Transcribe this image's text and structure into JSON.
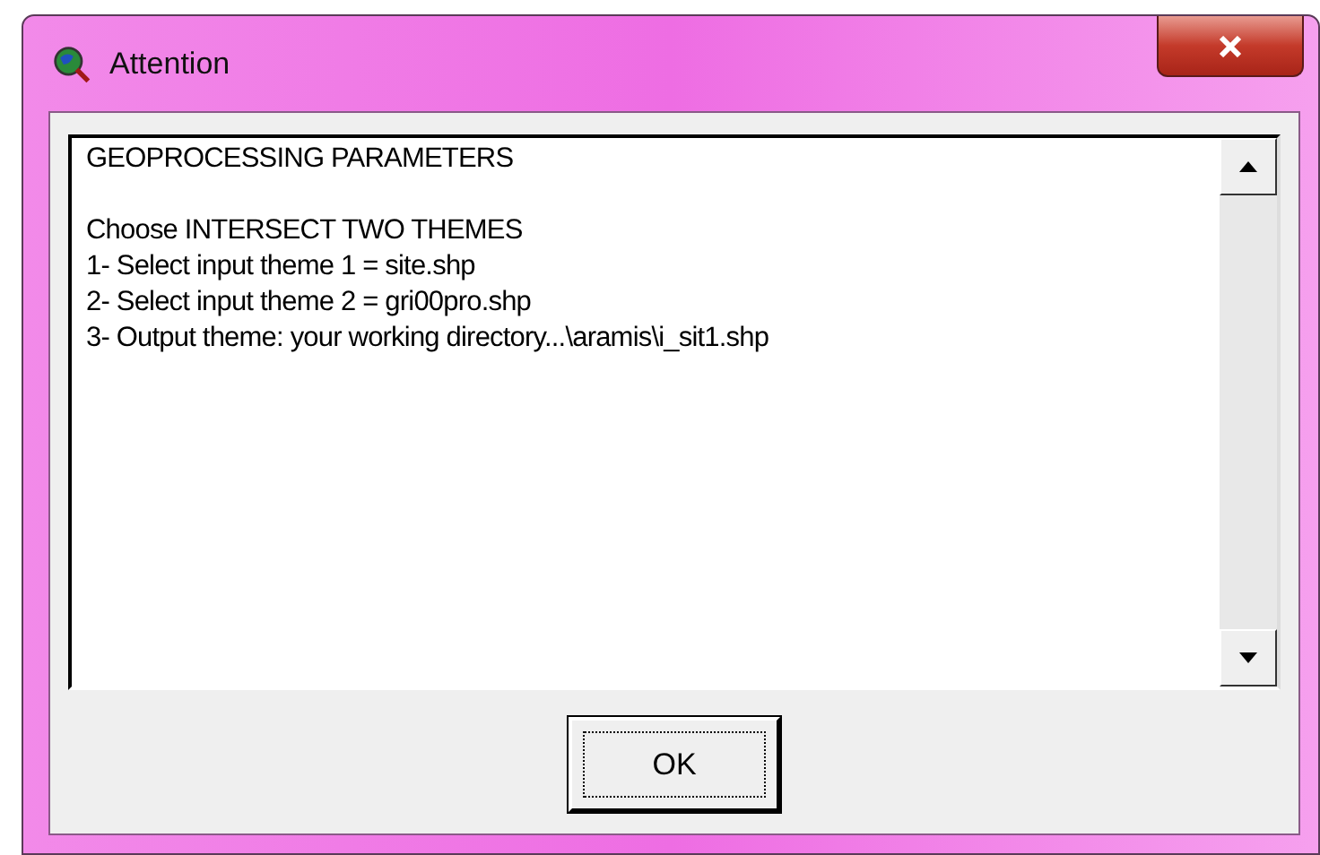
{
  "window": {
    "title": "Attention"
  },
  "message": {
    "paragraphs": [
      [
        "GEOPROCESSING PARAMETERS"
      ],
      [
        "Choose INTERSECT TWO THEMES",
        "1- Select input theme 1 = site.shp",
        "2- Select input theme 2 = gri00pro.shp",
        "3- Output theme: your working directory...\\aramis\\i_sit1.shp"
      ]
    ]
  },
  "buttons": [
    {
      "label": "OK",
      "focused": true
    }
  ]
}
